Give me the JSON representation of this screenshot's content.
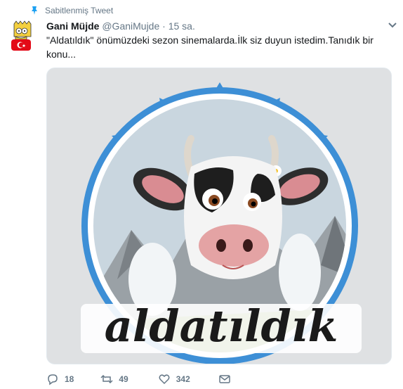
{
  "pinned_label": "Sabitlenmiş Tweet",
  "tweet": {
    "name": "Gani Müjde",
    "handle": "@GaniMujde",
    "separator": "·",
    "time": "15 sa.",
    "text": "\"Aldatıldık\" önümüzdeki sezon sinemalarda.İlk siz duyun istedim.Tanıdık bir konu..."
  },
  "media": {
    "logo_text": "aldatıldık",
    "colors": {
      "ring": "#3d8fd6",
      "background": "#dfe1e3",
      "sky": "#c9d6df"
    }
  },
  "actions": {
    "reply_count": "18",
    "retweet_count": "49",
    "like_count": "342"
  },
  "icons": [
    "pin-icon",
    "chevron-down-icon",
    "reply-icon",
    "retweet-icon",
    "like-icon",
    "message-icon"
  ]
}
